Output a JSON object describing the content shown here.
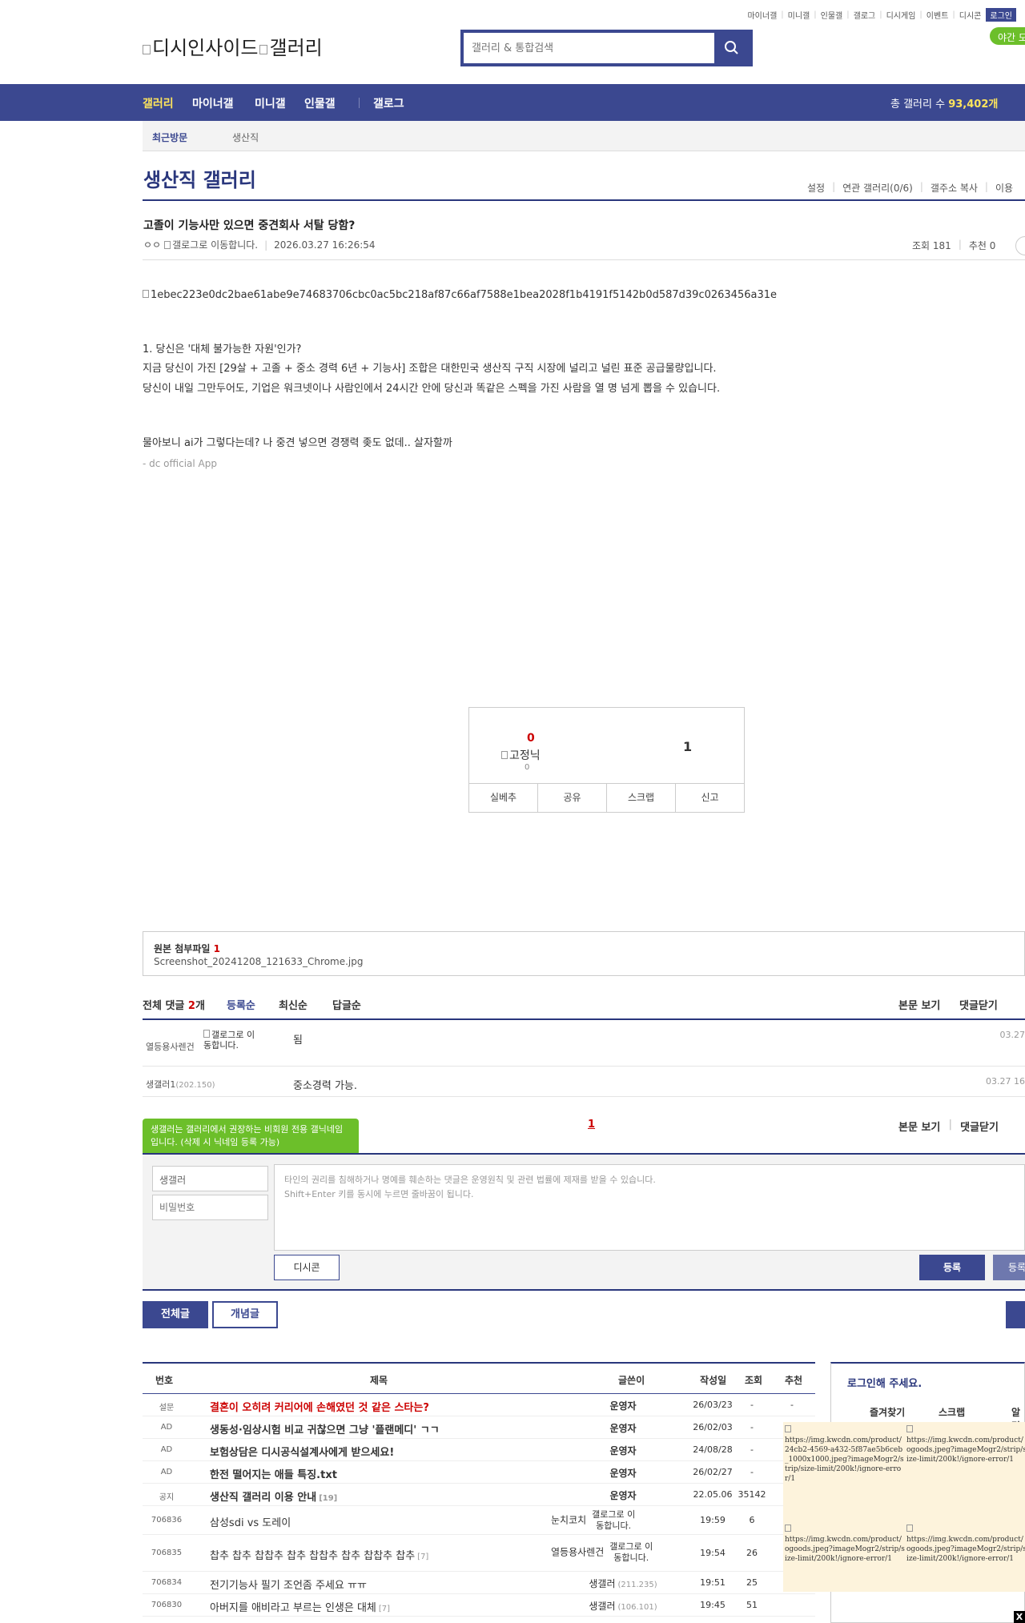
{
  "util_nav": {
    "items": [
      "마이너갤",
      "미니갤",
      "인물갤",
      "갤로그",
      "디시게임",
      "이벤트",
      "디시콘"
    ],
    "login": "로그인",
    "night_mode": "야간 모"
  },
  "logo_alt": "디시인사이드",
  "logo_gallery_alt": "갤러리",
  "search": {
    "placeholder": "갤러리 & 통합검색"
  },
  "gnb": {
    "items": [
      "갤러리",
      "마이너갤",
      "미니갤",
      "인물갤",
      "갤로그"
    ],
    "total_label": "총 갤러리 수",
    "total_value": "93,402개"
  },
  "recent": {
    "label": "최근방문",
    "item": "생산직"
  },
  "gallery": {
    "title": "생산직 갤러리",
    "tools": [
      "설정",
      "연관 갤러리(0/6)",
      "갤주소 복사",
      "이용"
    ]
  },
  "post": {
    "title": "고졸이 기능사만 있으면 중견회사 서탈 당함?",
    "author": "ㅇㅇ",
    "gallog_alt": "갤로그로 이동합니다.",
    "date": "2026.03.27 16:26:54",
    "views": "조회 181",
    "recommend": "추천 0",
    "image_alt": "1ebec223e0dc2bae61abe9e74683706cbc0ac5bc218af87c66af7588e1bea2028f1b4191f5142b0d587d39c0263456a31e",
    "lines": [
      "1. 당신은 '대체 불가능한 자원'인가?",
      "지금 당신이 가진 [29살 + 고졸 + 중소 경력 6년 + 기능사] 조합은 대한민국 생산직 구직 시장에 널리고 널린 표준 공급물량입니다.",
      "당신이 내일 그만두어도, 기업은 워크넷이나 사람인에서 24시간 안에 당신과 똑같은 스펙을 가진 사람을 열 명 넘게 뽑을 수 있습니다.",
      "물아보니 ai가 그렇다는데? 나 중견 넣으면 경쟁력 좆도 없데.. 살자할까"
    ],
    "app_tag": "- dc official App"
  },
  "recommend_box": {
    "up_count": "0",
    "fixed_alt": "고정닉",
    "fixed_count": "0",
    "down_count": "1",
    "actions": [
      "실베추",
      "공유",
      "스크랩",
      "신고"
    ]
  },
  "attachment": {
    "label": "원본 첨부파일",
    "count": "1",
    "file": "Screenshot_20241208_121633_Chrome.jpg"
  },
  "comments": {
    "label": "전체 댓글",
    "count": "2",
    "unit": "개",
    "sorts": [
      "등록순",
      "최신순",
      "답글순"
    ],
    "view_body": "본문 보기",
    "close": "댓글닫기",
    "items": [
      {
        "nick": "열등용사렌건",
        "ip": "",
        "gallog_alt": "갤로그로 이동합니다.",
        "text": "됨",
        "date": "03.27"
      },
      {
        "nick": "생갤러1",
        "ip": "(202.150)",
        "gallog_alt": "",
        "text": "중소경력 가능.",
        "date": "03.27 16"
      }
    ],
    "page": "1",
    "tooltip": "생갤러는 갤러리에서 권장하는 비회원 전용 갤닉네임입니다. (삭제 시 닉네임 등록 가능)"
  },
  "write": {
    "nick_value": "생갤러",
    "pw_placeholder": "비밀번호",
    "textarea_line1": "타인의 권리를 침해하거나 명예를 훼손하는 댓글은 운영원칙 및 관련 법률에 제재를 받을 수 있습니다.",
    "textarea_line2": "Shift+Enter 키를 동시에 누르면 줄바꿈이 됩니다.",
    "dccon": "디시콘",
    "submit": "등록",
    "submit2": "등록"
  },
  "list_tabs": {
    "all": "전체글",
    "best": "개념글"
  },
  "list": {
    "headers": [
      "번호",
      "제목",
      "글쓴이",
      "작성일",
      "조회",
      "추천"
    ],
    "rows": [
      {
        "num": "설문",
        "title": "결혼이 오히려 커리어에 손해였던 것 같은 스타는?",
        "reply": "",
        "writer": "운영자",
        "ip": "",
        "date": "26/03/23",
        "views": "-",
        "rec": "-"
      },
      {
        "num": "AD",
        "title": "생동성·임상시험 비교 귀찮으면 그냥 '플랜메디' ㄱㄱ",
        "reply": "",
        "writer": "운영자",
        "ip": "",
        "date": "26/02/03",
        "views": "-",
        "rec": ""
      },
      {
        "num": "AD",
        "title": "보험상담은 디시공식설계사에게 받으세요!",
        "reply": "",
        "writer": "운영자",
        "ip": "",
        "date": "24/08/28",
        "views": "-",
        "rec": ""
      },
      {
        "num": "AD",
        "title": "한전 떨어지는 애들 특징.txt",
        "reply": "",
        "writer": "운영자",
        "ip": "",
        "date": "26/02/27",
        "views": "-",
        "rec": ""
      },
      {
        "num": "공지",
        "title": "생산직 갤러리 이용 안내",
        "reply": "[19]",
        "writer": "운영자",
        "ip": "",
        "date": "22.05.06",
        "views": "35142",
        "rec": ""
      },
      {
        "num": "706836",
        "title": "삼성sdi vs 도레이",
        "reply": "",
        "writer": "눈치코치",
        "ip": "",
        "date": "19:59",
        "views": "6",
        "rec": ""
      },
      {
        "num": "706835",
        "title": "찹추 찹추 찹찹추 찹추 찹찹추 찹추 찹찹추 찹추",
        "reply": "[7]",
        "writer": "열등용사렌건",
        "ip": "",
        "date": "19:54",
        "views": "26",
        "rec": ""
      },
      {
        "num": "706834",
        "title": "전기기능사 필기 조언좀 주세요 ㅠㅠ",
        "reply": "",
        "writer": "생갤러",
        "ip": "(211.235)",
        "date": "19:51",
        "views": "25",
        "rec": ""
      },
      {
        "num": "706830",
        "title": "아버지를 애비라고 부르는 인생은 대체",
        "reply": "[7]",
        "writer": "생갤러",
        "ip": "(106.101)",
        "date": "19:45",
        "views": "51",
        "rec": ""
      }
    ],
    "gallog_alt": "갤로그로 이동합니다."
  },
  "side": {
    "title": "로그인해 주세요.",
    "tabs": [
      "즐겨찾기",
      "스크랩",
      "알림"
    ]
  },
  "ads": [
    "https://img.kwcdn.com/product/24cb2-4569-a432-5f87ae5b6ceb_1000x1000.jpeg?imageMogr2/strip/size-limit/200k!/ignore-error/1",
    "https://img.kwcdn.com/product/ogoods.jpeg?imageMogr2/strip/size-limit/200k!/ignore-error/1",
    "https://img.kwcdn.com/product/ogoods.jpeg?imageMogr2/strip/size-limit/200k!/ignore-error/1",
    "https://img.kwcdn.com/product/ogoods.jpeg?imageMogr2/strip/size-limit/200k!/ignore-error/1"
  ],
  "close_label": "X"
}
